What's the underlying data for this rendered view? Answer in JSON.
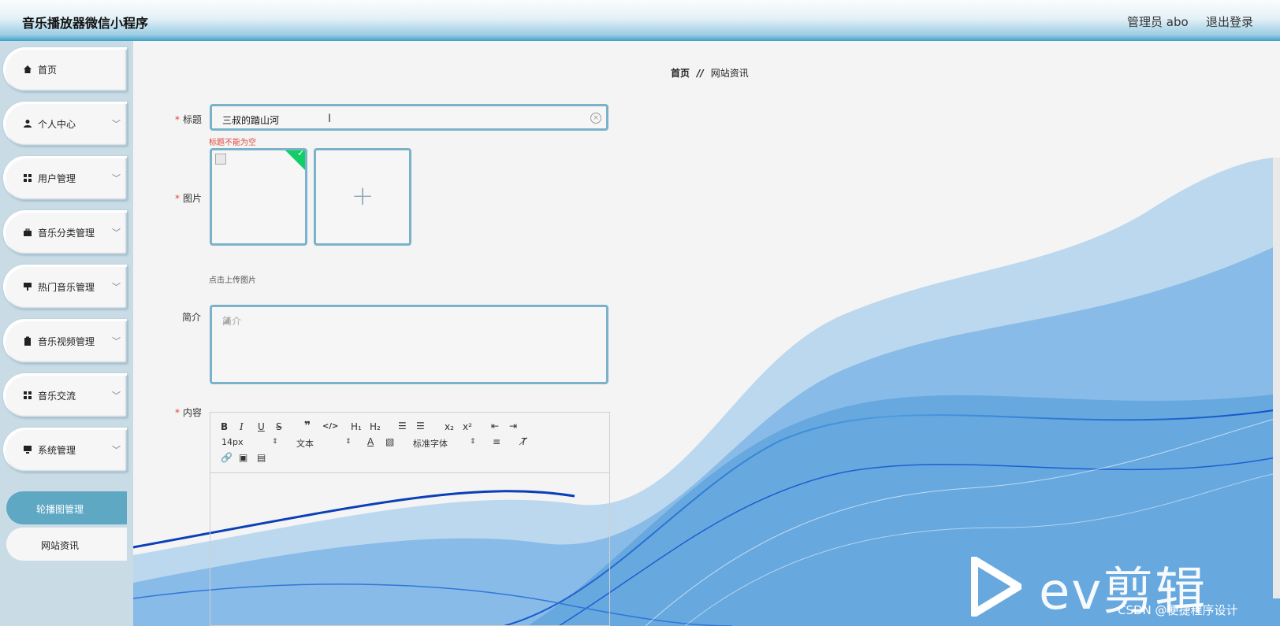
{
  "header": {
    "title": "音乐播放器微信小程序",
    "user": "管理员 abo",
    "logout": "退出登录"
  },
  "sidebar": {
    "items": [
      {
        "label": "首页",
        "icon": "home-icon",
        "expandable": false
      },
      {
        "label": "个人中心",
        "icon": "user-icon",
        "expandable": true
      },
      {
        "label": "用户管理",
        "icon": "grid-icon",
        "expandable": true
      },
      {
        "label": "音乐分类管理",
        "icon": "briefcase-icon",
        "expandable": true
      },
      {
        "label": "热门音乐管理",
        "icon": "hot-music-icon",
        "expandable": true
      },
      {
        "label": "音乐视频管理",
        "icon": "clipboard-icon",
        "expandable": true
      },
      {
        "label": "音乐交流",
        "icon": "grid-icon",
        "expandable": true
      },
      {
        "label": "系统管理",
        "icon": "monitor-icon",
        "expandable": true
      }
    ],
    "subitems": [
      {
        "label": "轮播图管理",
        "active": true
      },
      {
        "label": "网站资讯",
        "active": false
      }
    ]
  },
  "breadcrumb": {
    "home": "首页",
    "separator": "//",
    "current": "网站资讯"
  },
  "form": {
    "title_label": "标题",
    "title_value": "三叔的踏山河",
    "title_error": "标题不能为空",
    "image_label": "图片",
    "upload_hint": "点击上传图片",
    "intro_label": "简介",
    "intro_placeholder": "简介",
    "content_label": "内容"
  },
  "editor": {
    "font_size": "14px",
    "text_type": "文本",
    "font_family": "标准字体",
    "tools_row1": [
      "B",
      "I",
      "U",
      "S",
      "❞",
      "</>",
      "H1",
      "H2",
      "ol",
      "ul",
      "x₂",
      "x²",
      "outdent",
      "indent"
    ]
  },
  "watermark": {
    "brand": "ev剪辑",
    "credit": "CSDN @便捷程序设计"
  },
  "colors": {
    "accent": "#5fa8c4",
    "input_border": "#7ab3c9",
    "required": "#e0463c",
    "success": "#13ce66"
  }
}
